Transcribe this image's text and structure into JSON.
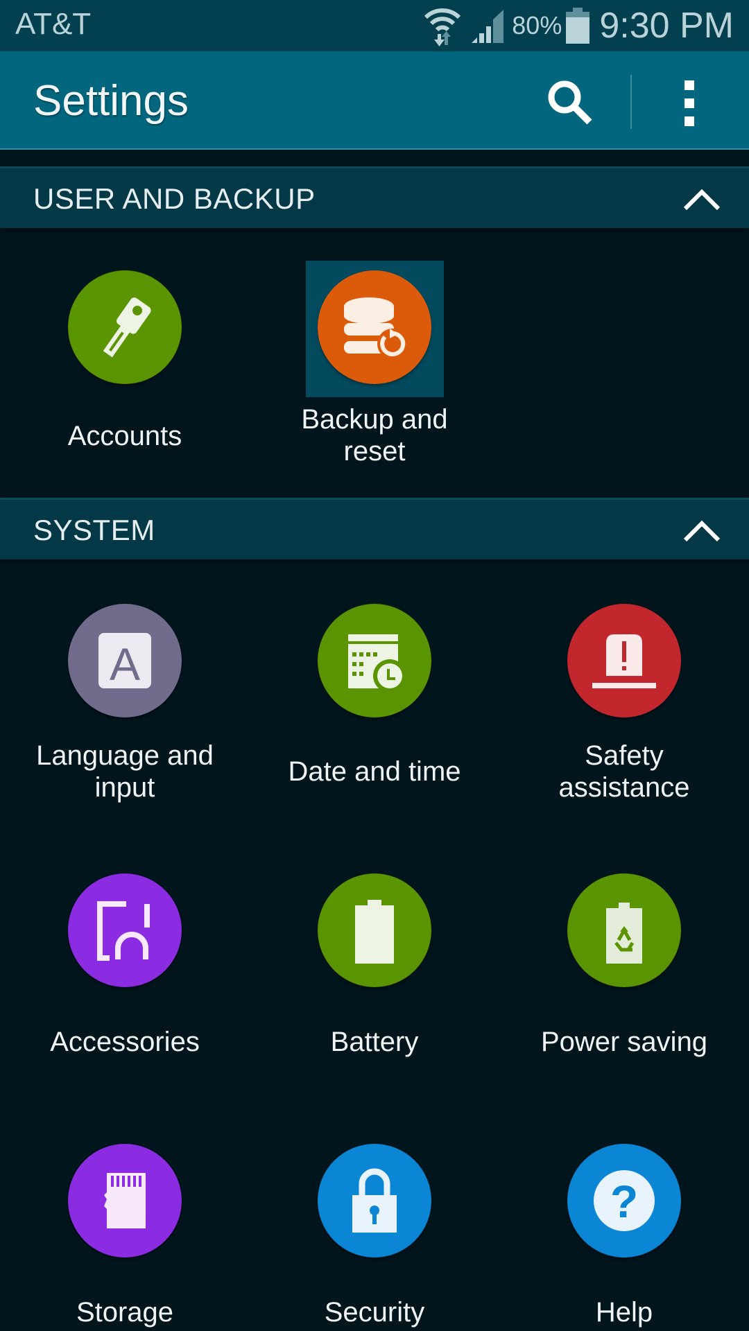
{
  "status_bar": {
    "carrier": "AT&T",
    "battery_percent": "80%",
    "time": "9:30 PM",
    "icons": [
      "wifi-data-icon",
      "signal-icon",
      "battery-icon"
    ]
  },
  "app_bar": {
    "title": "Settings",
    "actions": [
      "search-icon",
      "overflow-menu-icon"
    ]
  },
  "sections": [
    {
      "title": "USER AND BACKUP",
      "expanded": true,
      "items": [
        {
          "label": "Accounts",
          "icon": "key-icon",
          "color": "#5a9400"
        },
        {
          "label": "Backup and reset",
          "icon": "backup-restore-icon",
          "color": "#db5b0b",
          "selected": true
        }
      ]
    },
    {
      "title": "SYSTEM",
      "expanded": true,
      "items": [
        {
          "label": "Language and input",
          "icon": "language-icon",
          "color": "#716b8c"
        },
        {
          "label": "Date and time",
          "icon": "calendar-clock-icon",
          "color": "#5a9400"
        },
        {
          "label": "Safety assistance",
          "icon": "siren-alert-icon",
          "color": "#c1272d"
        },
        {
          "label": "Accessories",
          "icon": "accessories-icon",
          "color": "#8b2be2"
        },
        {
          "label": "Battery",
          "icon": "battery-icon",
          "color": "#5a9400"
        },
        {
          "label": "Power saving",
          "icon": "power-saving-icon",
          "color": "#5a9400"
        },
        {
          "label": "Storage",
          "icon": "sd-card-icon",
          "color": "#8b2be2"
        },
        {
          "label": "Security",
          "icon": "lock-icon",
          "color": "#0b86d5"
        },
        {
          "label": "Help",
          "icon": "help-icon",
          "color": "#0b86d5"
        }
      ]
    }
  ]
}
